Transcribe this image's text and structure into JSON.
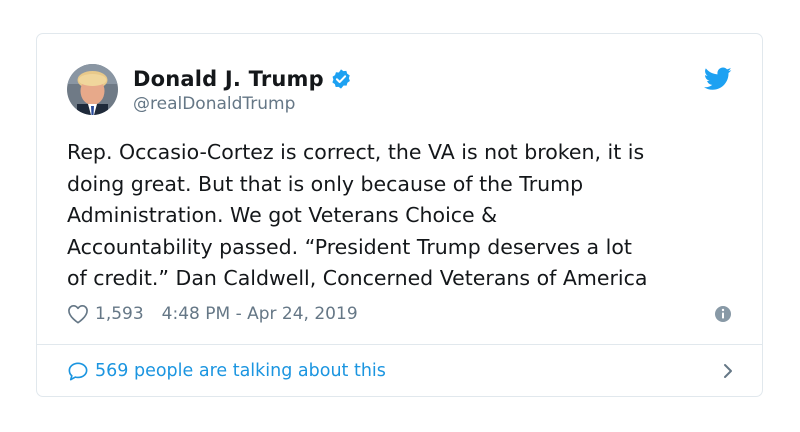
{
  "author": {
    "display_name": "Donald J. Trump",
    "handle": "@realDonaldTrump",
    "avatar_icon": "avatar-photo",
    "verified": true
  },
  "tweet": {
    "text_lines": [
      "Rep. Occasio-Cortez is correct, the VA is not broken, it is",
      "doing great. But that is only because of the Trump",
      "Administration. We got Veterans Choice &",
      "Accountability passed. “President Trump deserves a lot",
      "of credit.” Dan Caldwell, Concerned Veterans of America"
    ],
    "likes": "1,593",
    "timestamp": "4:48 PM - Apr 24, 2019"
  },
  "footer": {
    "conversation_label": "569 people are talking about this"
  },
  "icons": {
    "brand": "twitter-bird-icon",
    "verified": "verified-badge-icon",
    "like": "heart-icon",
    "info": "info-icon",
    "reply": "speech-bubble-icon",
    "chevron": "chevron-right-icon"
  },
  "colors": {
    "twitter_blue": "#1da1f2",
    "link_blue": "#1b95e0",
    "text_dark": "#14171a",
    "text_muted": "#657786",
    "border": "#e1e8ed"
  }
}
